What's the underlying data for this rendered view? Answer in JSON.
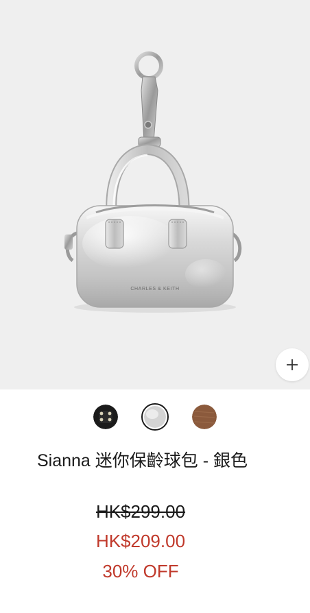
{
  "product": {
    "name": "Sianna 迷你保齡球包 - 銀色",
    "brand_mark": "CHARLES & KEITH",
    "image_alt": "Sianna 迷你保齡球包 銀色"
  },
  "colors": {
    "background": "#efefef",
    "price_sale": "#c0392b",
    "text": "#1a1a1a"
  },
  "swatches": [
    {
      "name": "black",
      "color": "#1b1b1b",
      "selected": false
    },
    {
      "name": "silver",
      "color": "#d6d6d6",
      "selected": true
    },
    {
      "name": "brown",
      "color": "#8b5a3c",
      "selected": false
    }
  ],
  "pricing": {
    "original": "HK$299.00",
    "sale": "HK$209.00",
    "discount": "30% OFF"
  },
  "icons": {
    "zoom": "plus-icon"
  }
}
